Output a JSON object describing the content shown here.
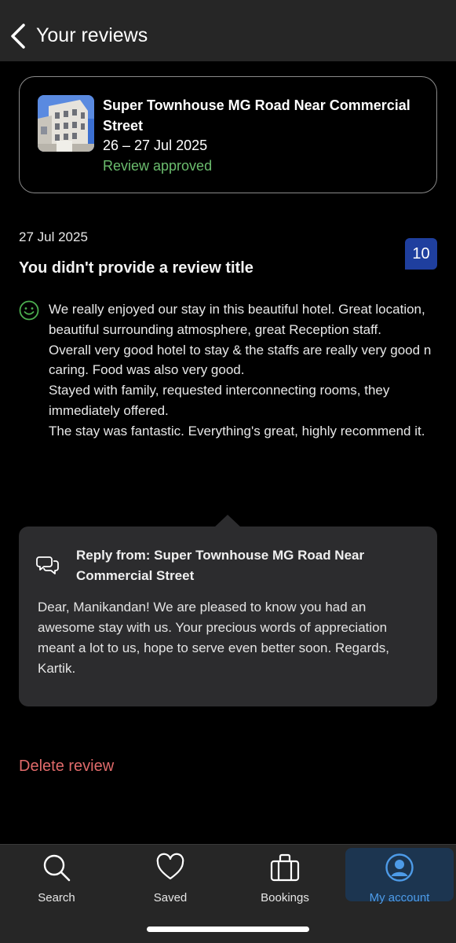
{
  "header": {
    "back_icon": "chevron-left-icon",
    "title": "Your reviews"
  },
  "property": {
    "name": "Super Townhouse MG Road Near Commercial Street",
    "dates": "26 – 27 Jul 2025",
    "status": "Review approved",
    "status_color": "#6bbd6e"
  },
  "review": {
    "date": "27 Jul 2025",
    "title": "You didn't provide a review title",
    "score": "10",
    "sentiment_icon": "smiley-icon",
    "paragraphs": [
      "We really enjoyed our stay in this beautiful hotel. Great location, beautiful surrounding atmosphere, great Reception staff.",
      "Overall very good hotel to stay & the staffs are really very good n caring. Food was also very good.",
      "Stayed with family, requested interconnecting rooms, they immediately offered.",
      "The stay was fantastic. Everything's great, highly recommend it."
    ]
  },
  "reply": {
    "icon": "chat-bubbles-icon",
    "heading": "Reply from: Super Townhouse MG Road Near Commercial Street",
    "text": "Dear, Manikandan!  We are pleased to know you had an awesome stay with us. Your precious words of appreciation meant a lot to us, hope to serve even better soon. Regards, Kartik."
  },
  "actions": {
    "delete_label": "Delete review"
  },
  "bottom_nav": {
    "items": [
      {
        "label": "Search",
        "icon": "search-icon"
      },
      {
        "label": "Saved",
        "icon": "heart-icon"
      },
      {
        "label": "Bookings",
        "icon": "briefcase-icon"
      },
      {
        "label": "My account",
        "icon": "account-icon",
        "active": true
      }
    ]
  },
  "colors": {
    "accent_blue": "#1f3f9e",
    "nav_active": "#4d9be8",
    "delete_red": "#e06a6a"
  }
}
